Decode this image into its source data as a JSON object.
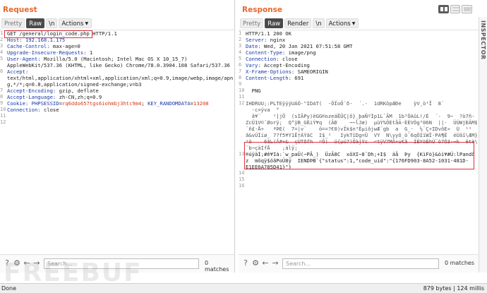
{
  "request": {
    "title": "Request",
    "tabs": [
      "Pretty",
      "Raw",
      "\\n",
      "Actions"
    ],
    "lines": [
      {
        "n": "1",
        "parts": [
          {
            "t": "GET /general/login_code.php HTTP/1.1",
            "c": ""
          }
        ]
      },
      {
        "n": "2",
        "parts": [
          {
            "t": "Host: 192.168.1.175",
            "c": "key"
          }
        ]
      },
      {
        "n": "3",
        "parts": [
          {
            "t": "Cache-Control: ",
            "c": "key"
          },
          {
            "t": "max-age=0",
            "c": ""
          }
        ]
      },
      {
        "n": "4",
        "parts": [
          {
            "t": "Upgrade-Insecure-Requests: ",
            "c": "key"
          },
          {
            "t": "1",
            "c": ""
          }
        ]
      },
      {
        "n": "5",
        "parts": [
          {
            "t": "User-Agent: ",
            "c": "key"
          },
          {
            "t": "Mozilla/5.0 (Macintosh; Intel Mac OS X 10_15_7)",
            "c": ""
          }
        ]
      },
      {
        "n": "",
        "parts": [
          {
            "t": "AppleWebKit/537.36 (KHTML, like Gecko) Chrome/78.0.3904.108 Safari/537.36",
            "c": ""
          }
        ]
      },
      {
        "n": "6",
        "parts": [
          {
            "t": "Accept: ",
            "c": "key"
          }
        ]
      },
      {
        "n": "",
        "parts": [
          {
            "t": "text/html,application/xhtml+xml,application/xml;q=0.9,image/webp,image/apn",
            "c": ""
          }
        ]
      },
      {
        "n": "",
        "parts": [
          {
            "t": "g,*/*;q=0.8,application/signed-exchange;v=b3",
            "c": ""
          }
        ]
      },
      {
        "n": "7",
        "parts": [
          {
            "t": "Accept-Encoding: ",
            "c": "key"
          },
          {
            "t": "gzip, deflate",
            "c": ""
          }
        ]
      },
      {
        "n": "8",
        "parts": [
          {
            "t": "Accept-Language: ",
            "c": "key"
          },
          {
            "t": "zh-CN,zh;q=0.9",
            "c": ""
          }
        ]
      },
      {
        "n": "9",
        "parts": [
          {
            "t": "Cookie: ",
            "c": "key"
          },
          {
            "t": "PHPSESSID",
            "c": "key"
          },
          {
            "t": "=",
            "c": ""
          },
          {
            "t": "rq6ddo657tgs6iohmbj3htc9m4",
            "c": "cookie-val"
          },
          {
            "t": "; ",
            "c": ""
          },
          {
            "t": "KEY_RANDOMDATA",
            "c": "key"
          },
          {
            "t": "=",
            "c": ""
          },
          {
            "t": "13208",
            "c": "cookie-val"
          }
        ]
      },
      {
        "n": "10",
        "parts": [
          {
            "t": "Connection: ",
            "c": "key"
          },
          {
            "t": "close",
            "c": ""
          }
        ]
      },
      {
        "n": "11",
        "parts": [
          {
            "t": "",
            "c": ""
          }
        ]
      },
      {
        "n": "12",
        "parts": [
          {
            "t": "",
            "c": ""
          }
        ]
      }
    ],
    "search_placeholder": "Search...",
    "matches": "0 matches"
  },
  "response": {
    "title": "Response",
    "tabs": [
      "Pretty",
      "Raw",
      "Render",
      "\\n",
      "Actions"
    ],
    "lines": [
      {
        "n": "1",
        "parts": [
          {
            "t": "HTTP/1.1 200 OK",
            "c": ""
          }
        ]
      },
      {
        "n": "2",
        "parts": [
          {
            "t": "Server: ",
            "c": "key"
          },
          {
            "t": "nginx",
            "c": ""
          }
        ]
      },
      {
        "n": "3",
        "parts": [
          {
            "t": "Date: ",
            "c": "key"
          },
          {
            "t": "Wed, 20 Jan 2021 07:51:58 GMT",
            "c": ""
          }
        ]
      },
      {
        "n": "4",
        "parts": [
          {
            "t": "Content-Type: ",
            "c": "key"
          },
          {
            "t": "image/png",
            "c": ""
          }
        ]
      },
      {
        "n": "5",
        "parts": [
          {
            "t": "Connection: ",
            "c": "key"
          },
          {
            "t": "close",
            "c": ""
          }
        ]
      },
      {
        "n": "6",
        "parts": [
          {
            "t": "Vary: ",
            "c": "key"
          },
          {
            "t": "Accept-Encoding",
            "c": ""
          }
        ]
      },
      {
        "n": "7",
        "parts": [
          {
            "t": "X-Frame-Options: ",
            "c": "key"
          },
          {
            "t": "SAMEORIGIN",
            "c": ""
          }
        ]
      },
      {
        "n": "8",
        "parts": [
          {
            "t": "Content-Length: ",
            "c": "key"
          },
          {
            "t": "691",
            "c": ""
          }
        ]
      },
      {
        "n": "9",
        "parts": [
          {
            "t": "",
            "c": ""
          }
        ]
      },
      {
        "n": "10",
        "parts": [
          {
            "t": "  PNG",
            "c": ""
          }
        ]
      },
      {
        "n": "11",
        "parts": [
          {
            "t": "",
            "c": ""
          }
        ]
      }
    ],
    "binary_lines": [
      "IHDRUU;:PLTEÿÿÿUÁÓ-\"IDAT(  -ÖÏoÕ`ð·  ´.·  1dRKôpÆÐe    ÿV¸ò¹Î  8¨",
      "  ·c¤ÿva  °",
      "  â¥¨    ²]jÕ  (sÌÂPy)ëGG®ozeäÊÛÇ|õ}_þaÑºÍp1L¨ÃM  1b³ÖAûL!/É  ´-  9~  ?ò7ñ-",
      "ZcÜ1V©¨Øorÿ;  Q°ÿB_GßiÝ¥q  (ÂÐ    ¬~lJæ)  µùÝ%ÖEtåÃ-ÈÉVÒg³06N  ||·  ÜÚWjÐÂM$",
      "¨ñ£·Å÷   ªÞÉ(  7=|v¨    ö==?€0)vÏk$n³ÊµiôjwÆ¨gb  a  G_·  ½¨Ç÷IDvõE»  Ù  ¹¹  O",
      "ã&vÚÏíø_ 7?f5¥Y1Ê†ÀÝâC  I$_¹   IykTîDg=Û  VY  N\\yyõ_ò¯6qÓIïWÏ-PA¶Ë  éÚâî\\ÆM}",
      "¹ö    6ãL(Â#+&  çÙTðfh  =Ô)  ü{µú7)ÕàjÝc  <tÿV7MÂ÷u€ã  ÌÉYòÈhÙ¨ò7Ó3·¬k  ëtè\\",
      "¨b¬çäÍfÅ    ;àlÿ;"
    ],
    "highlight_line_13": "®úÿäÍ;#ê¥Ià:`w_paÜ(~PÂ_)  ÜzÂ8C  xôXI~8¨Dh;+I$  äå  Þy  {KìFò}&òì¥#Ú:lPandô",
    "highlight_line_13b": "z  mõqÿ$öãPoÜ8ÿ  IENDÞB`{\"status\":1,\"code_uid\":\"{176FD903-8A52-1031-481D-",
    "highlight_line_13c": "E1EE6A785D41}\"}",
    "trailing_lines": [
      "14",
      "15",
      "16"
    ],
    "search_placeholder": "Search...",
    "matches": "0 matches"
  },
  "inspector_label": "INSPECTOR",
  "status": {
    "left": "Done",
    "right": "879 bytes | 124 millis"
  },
  "watermark": "FREEBUF",
  "colors": {
    "accent": "#e8672a",
    "highlight_box": "#e0303c",
    "header_key": "#1a38a8",
    "cookie_value": "#d23a1a"
  }
}
